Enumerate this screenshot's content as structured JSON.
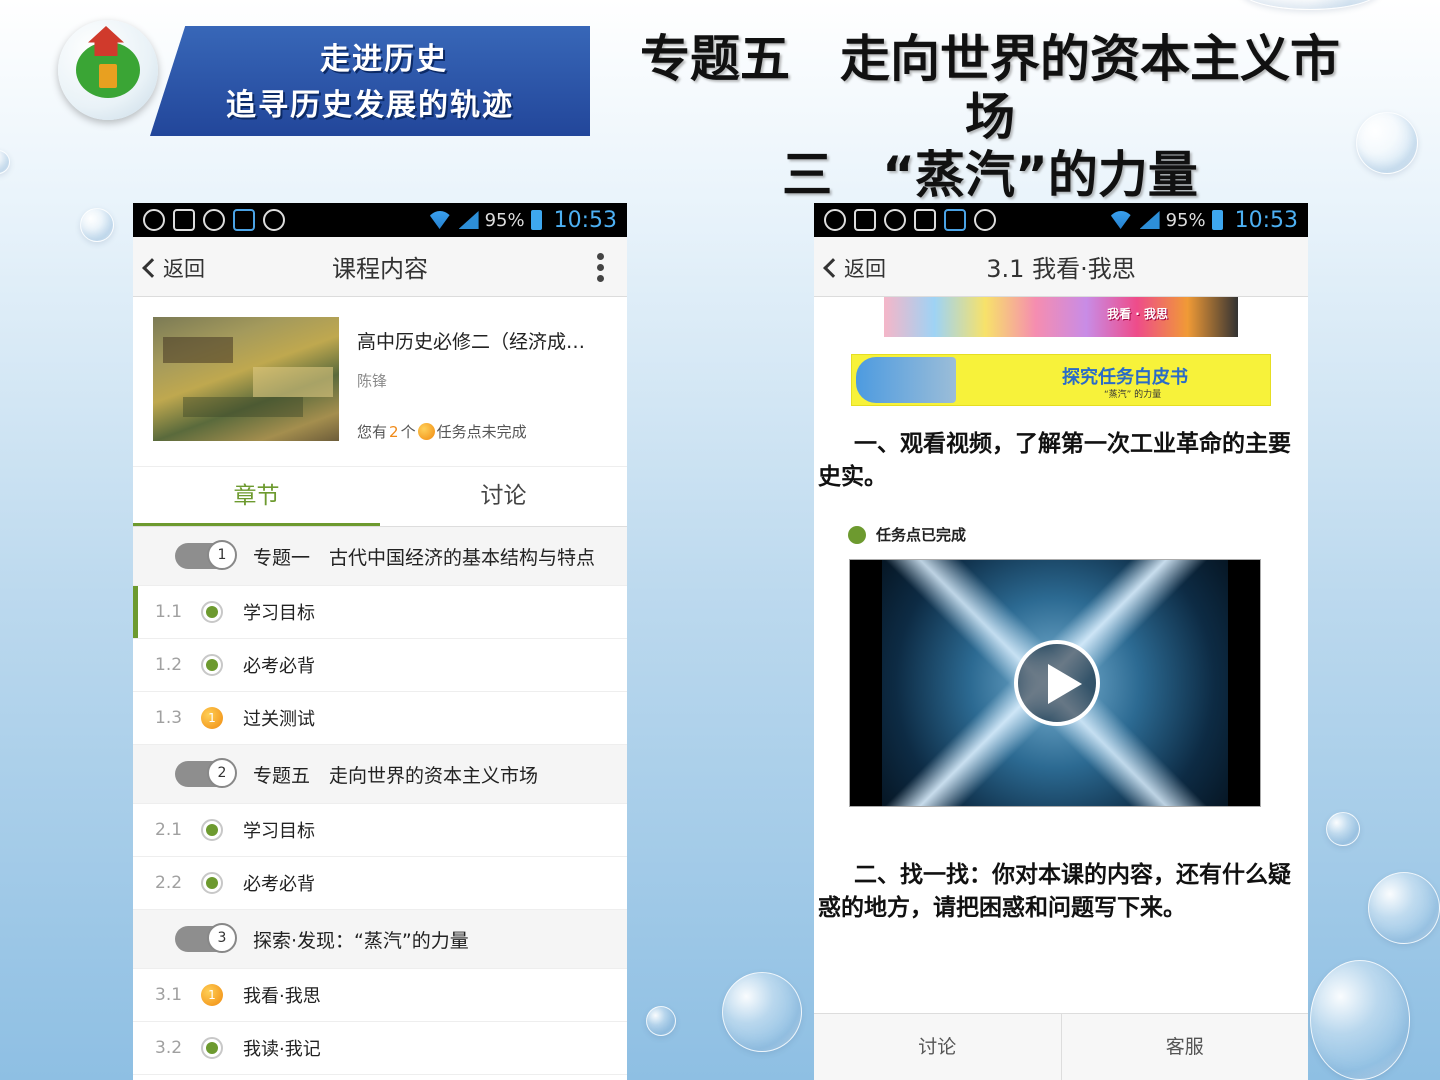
{
  "header": {
    "banner_line1": "走进历史",
    "banner_line2": "追寻历史发展的轨迹",
    "title_line1": "专题五　走向世界的资本主义市场",
    "title_line2": "三　“蒸汽”的力量"
  },
  "status_bar": {
    "battery": "95%",
    "time": "10:53"
  },
  "left_phone": {
    "back_label": "返回",
    "title": "课程内容",
    "course": {
      "title": "高中历史必修二（经济成…",
      "teacher": "陈锋",
      "task_prefix": "您有",
      "task_count": "2",
      "task_mid": "个",
      "task_suffix": "任务点未完成"
    },
    "tabs": [
      {
        "label": "章节",
        "active": true
      },
      {
        "label": "讨论",
        "active": false
      }
    ],
    "chapters": [
      {
        "type": "head",
        "num": "1",
        "label": "专题一　古代中国经济的基本结构与特点"
      },
      {
        "type": "item",
        "idx": "1.1",
        "state": "done",
        "label": "学习目标"
      },
      {
        "type": "item",
        "idx": "1.2",
        "state": "done",
        "label": "必考必背"
      },
      {
        "type": "item",
        "idx": "1.3",
        "state": "pending",
        "badge": "1",
        "label": "过关测试"
      },
      {
        "type": "head",
        "num": "2",
        "label": "专题五　走向世界的资本主义市场"
      },
      {
        "type": "item",
        "idx": "2.1",
        "state": "done",
        "label": "学习目标"
      },
      {
        "type": "item",
        "idx": "2.2",
        "state": "done",
        "label": "必考必背"
      },
      {
        "type": "head",
        "num": "3",
        "label": "探索·发现：“蒸汽”的力量"
      },
      {
        "type": "item",
        "idx": "3.1",
        "state": "pending",
        "badge": "1",
        "label": "我看·我思"
      },
      {
        "type": "item",
        "idx": "3.2",
        "state": "done",
        "label": "我读·我记"
      }
    ]
  },
  "right_phone": {
    "back_label": "返回",
    "title": "3.1 我看·我思",
    "banner_text": "我看 · 我思",
    "task_banner_title": "探究任务白皮书",
    "task_banner_sub": "“蒸汽” 的力量",
    "question1": "一、观看视频，了解第一次工业革命的主要史实。",
    "task_status": "任务点已完成",
    "question2": "二、找一找：你对本课的内容，还有什么疑惑的地方，请把困惑和问题写下来。",
    "bottom_left": "讨论",
    "bottom_right": "客服"
  }
}
